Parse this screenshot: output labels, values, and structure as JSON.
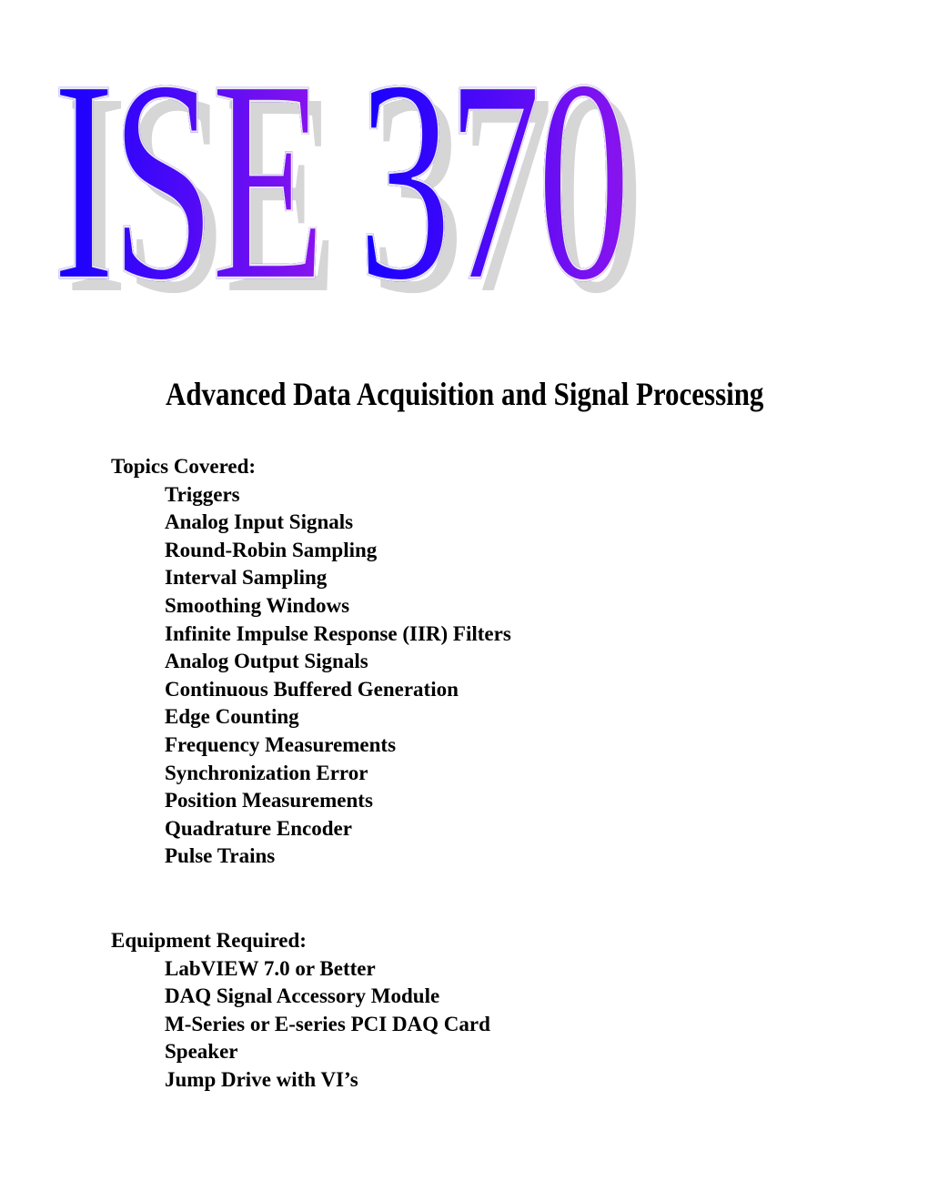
{
  "document": {
    "title": {
      "left_part": "ISE",
      "right_part": "370",
      "colors": {
        "gradient_start": "#1400ff",
        "gradient_end": "#8a14ee",
        "shadow": "#d6d6d6"
      }
    },
    "subtitle": "Advanced Data Acquisition and Signal Processing",
    "topics": {
      "heading": "Topics Covered:",
      "items": [
        "Triggers",
        "Analog Input Signals",
        "Round-Robin Sampling",
        "Interval Sampling",
        "Smoothing Windows",
        "Infinite Impulse Response (IIR) Filters",
        "Analog Output Signals",
        "Continuous Buffered Generation",
        "Edge Counting",
        "Frequency Measurements",
        "Synchronization Error",
        "Position Measurements",
        "Quadrature Encoder",
        "Pulse Trains"
      ]
    },
    "equipment": {
      "heading": "Equipment Required:",
      "items": [
        "LabVIEW 7.0 or Better",
        "DAQ Signal Accessory Module",
        "M-Series or E-series PCI DAQ Card",
        "Speaker",
        "Jump Drive with VI’s"
      ]
    }
  }
}
